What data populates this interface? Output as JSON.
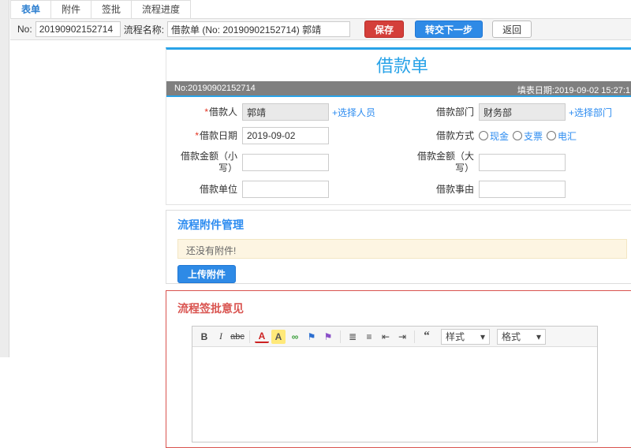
{
  "colors": {
    "accent_blue": "#29a3e8",
    "link_blue": "#2d8cf0",
    "danger_red": "#d9534f"
  },
  "tabs": [
    {
      "label": "表单",
      "active": true
    },
    {
      "label": "附件",
      "active": false
    },
    {
      "label": "签批",
      "active": false
    },
    {
      "label": "流程进度",
      "active": false
    }
  ],
  "toolbar": {
    "no_label": "No:",
    "no_value": "20190902152714",
    "process_name_label": "流程名称:",
    "process_name_value": "借款单 (No: 20190902152714) 郭靖",
    "save_label": "保存",
    "next_label": "转交下一步",
    "back_label": "返回"
  },
  "form": {
    "title": "借款单",
    "no_text": "No:20190902152714",
    "date_text": "填表日期:2019-09-02 15:27:1",
    "required_mark": "*",
    "fields": {
      "borrower_label": "借款人",
      "borrower_value": "郭靖",
      "select_person_link": "+选择人员",
      "department_label": "借款部门",
      "department_value": "财务部",
      "select_department_link": "+选择部门",
      "date_label": "借款日期",
      "date_value": "2019-09-02",
      "method_label": "借款方式",
      "methods": [
        "现金",
        "支票",
        "电汇"
      ],
      "amount_small_label": "借款金额（小写）",
      "amount_big_label": "借款金额（大写）",
      "unit_label": "借款单位",
      "reason_label": "借款事由"
    }
  },
  "attachment": {
    "title": "流程附件管理",
    "empty_text": "还没有附件!",
    "upload_label": "上传附件"
  },
  "approval": {
    "title": "流程签批意见",
    "editor": {
      "icons": {
        "bold": "B",
        "italic": "I",
        "strikethrough": "abc",
        "font_color": "A",
        "highlight": "A",
        "link": "∞",
        "flag_blue": "⚑",
        "flag_purple": "⚑",
        "ordered_list": "≣",
        "unordered_list": "≡",
        "outdent": "⇤",
        "indent": "⇥",
        "blockquote": "“"
      },
      "style_dropdown": "样式",
      "format_dropdown": "格式",
      "caret": "▾"
    }
  }
}
